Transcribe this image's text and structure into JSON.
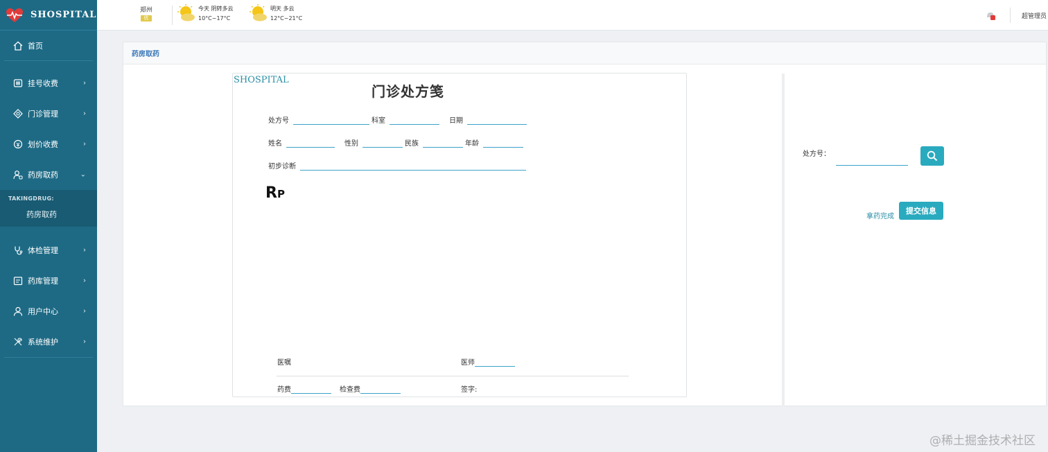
{
  "app": {
    "logo_text": "SHOSPITAL"
  },
  "sidebar": {
    "home": "首页",
    "items": [
      {
        "label": "挂号收费",
        "icon": "card-icon"
      },
      {
        "label": "门诊管理",
        "icon": "diamond-icon"
      },
      {
        "label": "划价收费",
        "icon": "coin-icon"
      },
      {
        "label": "药房取药",
        "icon": "pharmacist-icon",
        "expanded": true
      },
      {
        "label": "体检管理",
        "icon": "stethoscope-icon"
      },
      {
        "label": "药库管理",
        "icon": "warehouse-icon"
      },
      {
        "label": "用户中心",
        "icon": "user-icon"
      },
      {
        "label": "系统维护",
        "icon": "tools-icon"
      }
    ],
    "submenu": {
      "heading": "TAKINGDRUG:",
      "item": "药房取药"
    }
  },
  "topbar": {
    "city": "郑州",
    "today": {
      "label": "今天",
      "condition": "阴转多云",
      "temp": "10°C~17°C"
    },
    "tomorrow": {
      "label": "明天",
      "condition": "多云",
      "temp": "12°C~21°C"
    },
    "admin": "超管理员"
  },
  "panel": {
    "title": "药房取药"
  },
  "prescription": {
    "brand": "SHOSPITAL",
    "title": "门诊处方笺",
    "fields": {
      "rx_no": "处方号",
      "dept": "科室",
      "date": "日期",
      "name": "姓名",
      "gender": "性别",
      "ethnicity": "民族",
      "age": "年龄",
      "diagnosis": "初步诊断",
      "advice": "医嘱",
      "doctor": "医师",
      "drug_fee": "药费",
      "exam_fee": "检查费",
      "signature": "签字:"
    },
    "rp_main": "R",
    "rp_sub": "P"
  },
  "side_form": {
    "rx_label": "处方号：",
    "rx_value": "",
    "done_link": "拿药完成",
    "submit_label": "提交信息"
  },
  "watermark": "@稀土掘金技术社区",
  "colors": {
    "sidebar": "#1e6a85",
    "accent": "#2aaabf",
    "link": "#3a78b8"
  }
}
